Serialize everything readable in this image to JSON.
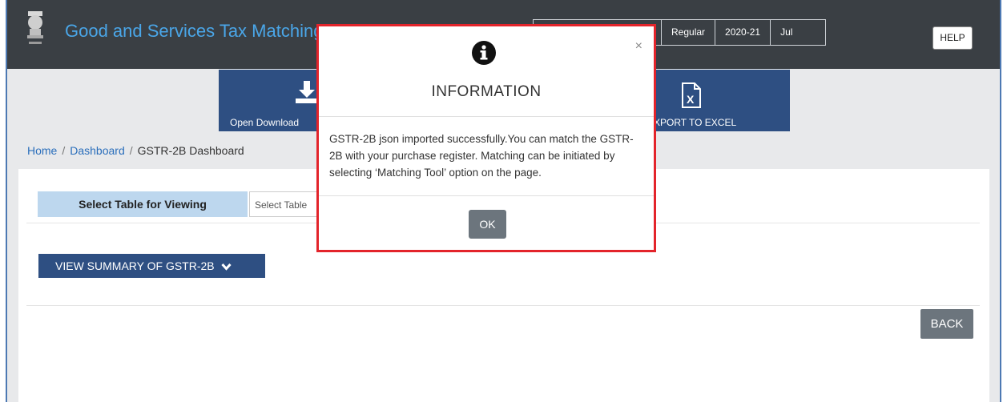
{
  "header": {
    "title": "Good and Services Tax Matching",
    "info": {
      "filing": "",
      "type": "Regular",
      "year": "2020-21",
      "month": "Jul"
    },
    "help_label": "HELP"
  },
  "tiles": {
    "open_download": "Open Download",
    "export_excel": "XPORT TO EXCEL"
  },
  "breadcrumb": {
    "home": "Home",
    "dashboard": "Dashboard",
    "current": "GSTR-2B Dashboard"
  },
  "panel": {
    "select_label": "Select Table for Viewing",
    "select_placeholder": "Select Table",
    "summary_button": "VIEW SUMMARY OF GSTR-2B",
    "back_button": "BACK"
  },
  "modal": {
    "title": "INFORMATION",
    "body": "GSTR-2B json imported successfully.You can match the GSTR-2B with your purchase register. Matching can be initiated by selecting ‘Matching Tool’ option on the page.",
    "ok_label": "OK",
    "close_glyph": "×"
  },
  "colors": {
    "header_bg": "#3a3f44",
    "accent_blue": "#2e4f82",
    "title_blue": "#4aa6e8",
    "modal_border": "#e3242b",
    "button_gray": "#6c757d"
  }
}
